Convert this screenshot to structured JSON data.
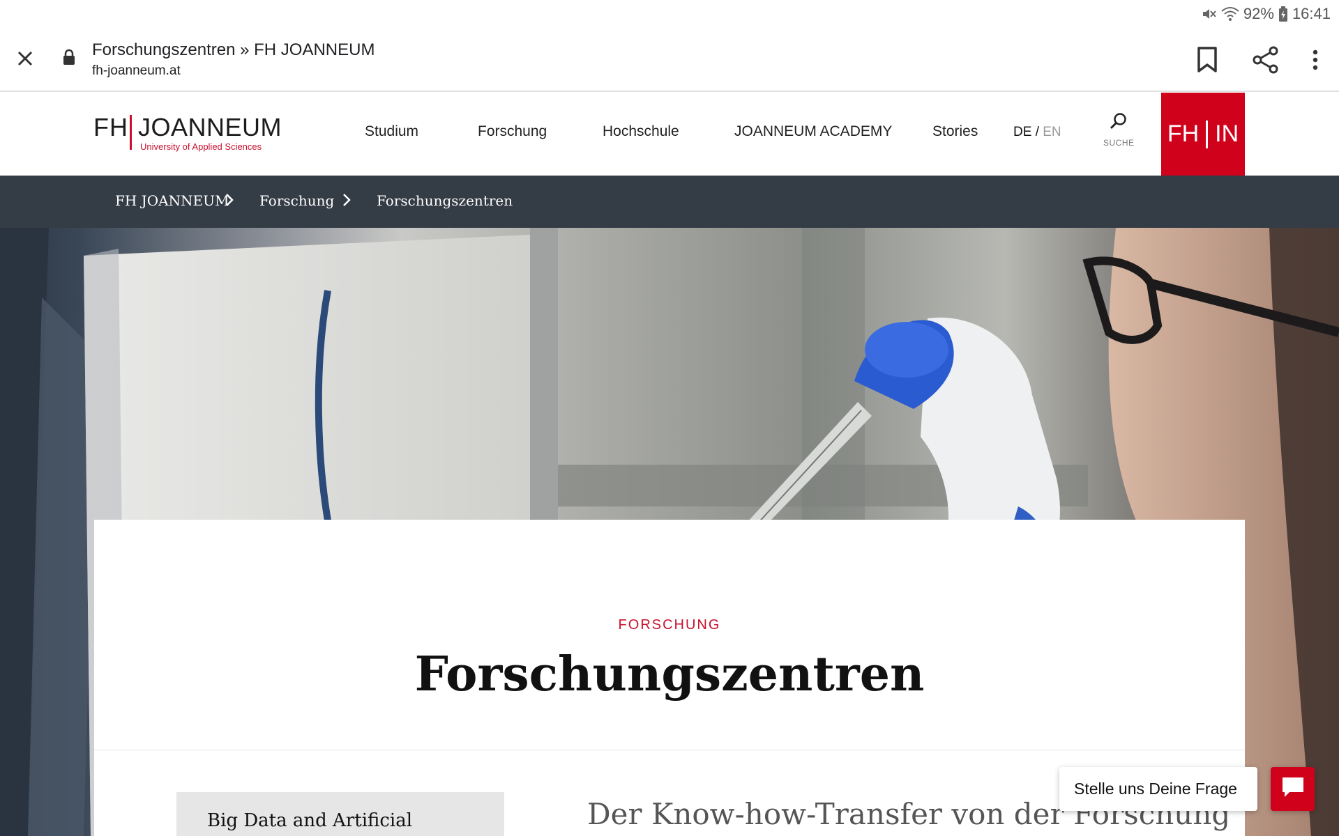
{
  "status_bar": {
    "battery": "92%",
    "time": "16:41",
    "icons": [
      "mute-icon",
      "wifi-icon",
      "battery-icon"
    ]
  },
  "browser": {
    "page_title": "Forschungszentren » FH JOANNEUM",
    "url": "fh-joanneum.at",
    "icons": [
      "close-icon",
      "lock-icon",
      "bookmark-icon",
      "share-icon",
      "more-vert-icon"
    ]
  },
  "header": {
    "logo": {
      "fh": "FH",
      "name": "JOANNEUM",
      "tagline": "University of Applied Sciences"
    },
    "nav": [
      "Studium",
      "Forschung",
      "Hochschule",
      "JOANNEUM ACADEMY",
      "Stories"
    ],
    "lang": {
      "de": "DE",
      "sep": "/",
      "en": "EN"
    },
    "search_label": "SUCHE",
    "fhin": {
      "left": "FH",
      "right": "IN"
    },
    "accent": "#d0021b"
  },
  "breadcrumb": {
    "items": [
      "FH JOANNEUM",
      "Forschung",
      "Forschungszentren"
    ],
    "background": "#343c46"
  },
  "content": {
    "kicker": "FORSCHUNG",
    "title": "Forschungszentren",
    "sidebar_item": "Big Data and Artificial",
    "lead": "Der Know-how-Transfer von der Forschung"
  },
  "chat": {
    "prompt": "Stelle uns Deine Frage",
    "icon": "chat-icon"
  }
}
